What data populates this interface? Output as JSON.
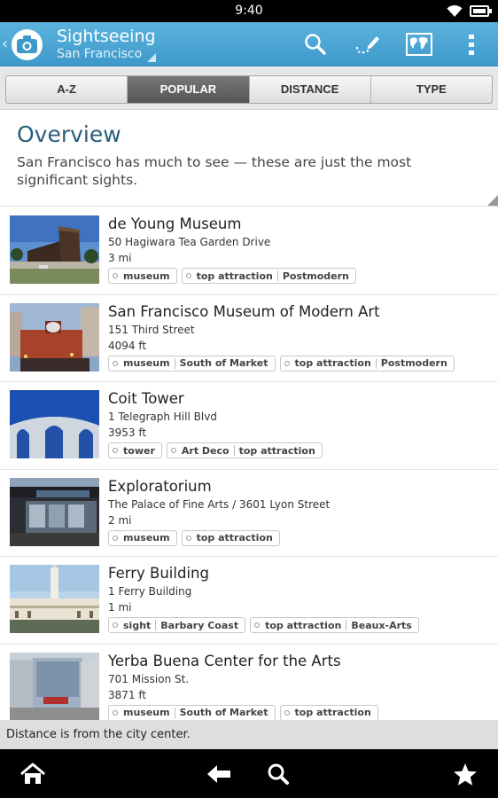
{
  "status": {
    "time": "9:40"
  },
  "actionbar": {
    "title": "Sightseeing",
    "subtitle": "San Francisco"
  },
  "tabs": [
    {
      "label": "A-Z",
      "active": false
    },
    {
      "label": "POPULAR",
      "active": true
    },
    {
      "label": "DISTANCE",
      "active": false
    },
    {
      "label": "TYPE",
      "active": false
    }
  ],
  "overview": {
    "title": "Overview",
    "text": "San Francisco has much to see — these are just the most significant sights."
  },
  "items": [
    {
      "name": "de Young Museum",
      "address": "50 Hagiwara Tea Garden Drive",
      "distance": "3 mi",
      "tags": [
        [
          "museum"
        ],
        [
          "top attraction",
          "Postmodern"
        ]
      ]
    },
    {
      "name": "San Francisco Museum of Modern Art",
      "address": "151 Third Street",
      "distance": "4094 ft",
      "tags": [
        [
          "museum",
          "South of Market"
        ],
        [
          "top attraction",
          "Postmodern"
        ]
      ]
    },
    {
      "name": "Coit Tower",
      "address": "1 Telegraph Hill Blvd",
      "distance": "3953 ft",
      "tags": [
        [
          "tower"
        ],
        [
          "Art Deco",
          "top attraction"
        ]
      ]
    },
    {
      "name": "Exploratorium",
      "address": "The Palace of Fine Arts / 3601 Lyon Street",
      "distance": "2 mi",
      "tags": [
        [
          "museum"
        ],
        [
          "top attraction"
        ]
      ]
    },
    {
      "name": "Ferry Building",
      "address": "1 Ferry Building",
      "distance": "1 mi",
      "tags": [
        [
          "sight",
          "Barbary Coast"
        ],
        [
          "top attraction",
          "Beaux-Arts"
        ]
      ]
    },
    {
      "name": "Yerba Buena Center for the Arts",
      "address": "701 Mission St.",
      "distance": "3871 ft",
      "tags": [
        [
          "museum",
          "South of Market"
        ],
        [
          "top attraction"
        ]
      ]
    }
  ],
  "footer_note": "Distance is from the city center.",
  "colors": {
    "actionbar": "#4aa6d4",
    "title_blue": "#2a5d7c"
  }
}
